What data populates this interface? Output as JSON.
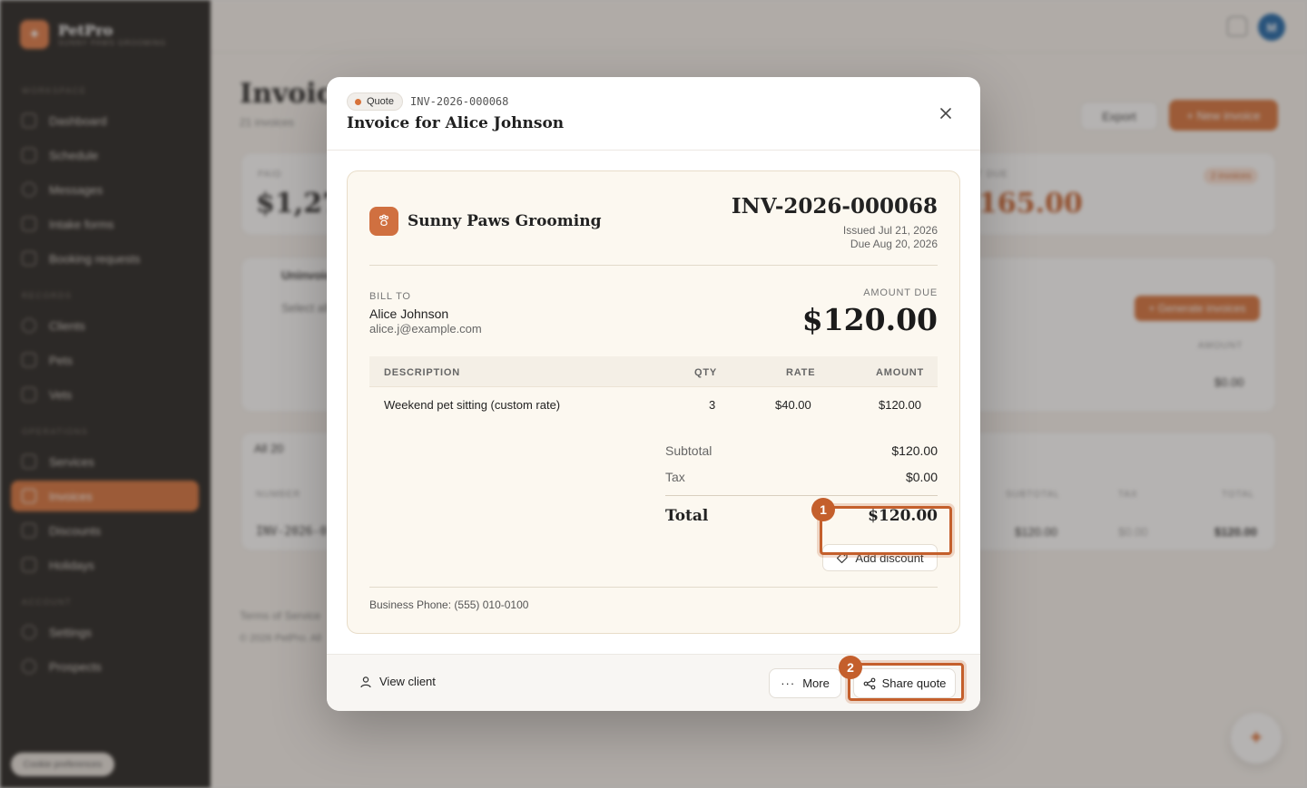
{
  "brand": {
    "name": "PetPro",
    "subtitle": "SUNNY PAWS GROOMING"
  },
  "sidebar": {
    "sections": [
      {
        "label": "WORKSPACE",
        "items": [
          "Dashboard",
          "Schedule",
          "Messages",
          "Intake forms",
          "Booking requests"
        ]
      },
      {
        "label": "RECORDS",
        "items": [
          "Clients",
          "Pets",
          "Vets"
        ]
      },
      {
        "label": "OPERATIONS",
        "items": [
          "Services",
          "Invoices",
          "Discounts",
          "Holidays"
        ]
      },
      {
        "label": "ACCOUNT",
        "items": [
          "Settings",
          "Prospects"
        ]
      }
    ],
    "active_item": "Invoices",
    "cookie_label": "Cookie preferences"
  },
  "header": {
    "avatar_initial": "M"
  },
  "page": {
    "title": "Invoices",
    "subtitle": "21 invoices",
    "export_label": "Export",
    "new_label": "+ New invoice",
    "stats": {
      "paid_label": "PAID",
      "paid_value": "$1,276",
      "due_label": "T DUE",
      "due_value": "165.00",
      "due_badge": "2 invoices"
    },
    "uninvoiced": {
      "title": "Uninvoiced",
      "select_all": "Select all",
      "generate_label": "+ Generate invoices",
      "amount_header": "AMOUNT",
      "amount_value": "$0.00"
    },
    "filter": {
      "all_label": "All",
      "all_count": "20"
    },
    "table": {
      "headers": {
        "number": "NUMBER",
        "subtotal": "SUBTOTAL",
        "tax": "TAX",
        "total": "TOTAL"
      },
      "row": {
        "number": "INV-2026-0",
        "subtotal": "$120.00",
        "tax": "$0.00",
        "total": "$120.00"
      }
    },
    "footer": {
      "terms": "Terms of Service",
      "copyright": "© 2026 PetPro. All"
    }
  },
  "modal": {
    "status": "Quote",
    "number": "INV-2026-000068",
    "title": "Invoice for Alice Johnson",
    "document": {
      "business_name": "Sunny Paws Grooming",
      "number": "INV-2026-000068",
      "issued": "Issued Jul 21, 2026",
      "due": "Due Aug 20, 2026",
      "bill_to_label": "BILL TO",
      "client_name": "Alice Johnson",
      "client_email": "alice.j@example.com",
      "amount_due_label": "AMOUNT DUE",
      "amount_due": "$120.00",
      "columns": {
        "description": "DESCRIPTION",
        "qty": "QTY",
        "rate": "RATE",
        "amount": "AMOUNT"
      },
      "items": [
        {
          "description": "Weekend pet sitting (custom rate)",
          "qty": "3",
          "rate": "$40.00",
          "amount": "$120.00"
        }
      ],
      "subtotal_label": "Subtotal",
      "subtotal": "$120.00",
      "tax_label": "Tax",
      "tax": "$0.00",
      "total_label": "Total",
      "total": "$120.00",
      "add_discount_label": "Add discount",
      "business_phone": "Business Phone: (555) 010-0100"
    },
    "footer": {
      "view_client_label": "View client",
      "more_label": "More",
      "share_label": "Share quote"
    }
  },
  "annotations": [
    {
      "number": "1",
      "target": "total-value"
    },
    {
      "number": "2",
      "target": "share-quote-button"
    }
  ],
  "colors": {
    "accent": "#d7723a",
    "annotation": "#c45f2c",
    "document_bg": "#fcf8f0",
    "sidebar_bg": "#23211f"
  }
}
